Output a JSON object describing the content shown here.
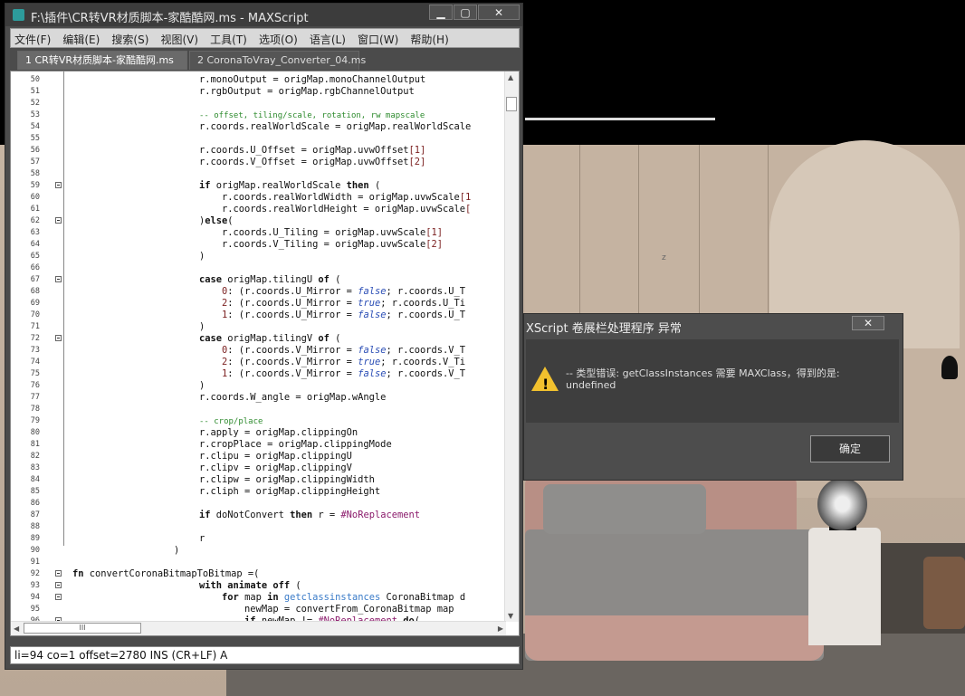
{
  "editor": {
    "title": "F:\\插件\\CR转VR材质脚本-家酷酷网.ms - MAXScript",
    "window_buttons": {
      "minimize": "▁",
      "maximize": "▢",
      "close": "✕"
    },
    "menu": [
      "文件(F)",
      "编辑(E)",
      "搜索(S)",
      "视图(V)",
      "工具(T)",
      "选项(O)",
      "语言(L)",
      "窗口(W)",
      "帮助(H)"
    ],
    "tabs": [
      "1 CR转VR材质脚本-家酷酷网.ms",
      "2 CoronaToVray_Converter_04.ms"
    ],
    "active_tab": 0,
    "lines": [
      {
        "n": "50",
        "html": "r.monoOutput = origMap.monoChannelOutput"
      },
      {
        "n": "51",
        "html": "r.rgbOutput = origMap.rgbChannelOutput"
      },
      {
        "n": "52",
        "html": ""
      },
      {
        "n": "53",
        "html": "<span class='cm'>-- offset, tiling/scale, rotation, rw mapscale</span>"
      },
      {
        "n": "54",
        "html": "r.coords.realWorldScale = origMap.realWorldScale"
      },
      {
        "n": "55",
        "html": ""
      },
      {
        "n": "56",
        "html": "r.coords.U_Offset = origMap.uvwOffset<span class='nm'>[1]</span>"
      },
      {
        "n": "57",
        "html": "r.coords.V_Offset = origMap.uvwOffset<span class='nm'>[2]</span>"
      },
      {
        "n": "58",
        "html": ""
      },
      {
        "n": "59",
        "html": "<span class='kw'>if</span> origMap.realWorldScale <span class='kw'>then</span> (",
        "fold": true
      },
      {
        "n": "60",
        "html": "    r.coords.realWorldWidth = origMap.uvwScale<span class='nm'>[1</span>"
      },
      {
        "n": "61",
        "html": "    r.coords.realWorldHeight = origMap.uvwScale<span class='nm'>[</span>"
      },
      {
        "n": "62",
        "html": ")<span class='kw'>else</span>(",
        "fold": true
      },
      {
        "n": "63",
        "html": "    r.coords.U_Tiling = origMap.uvwScale<span class='nm'>[1]</span>"
      },
      {
        "n": "64",
        "html": "    r.coords.V_Tiling = origMap.uvwScale<span class='nm'>[2]</span>"
      },
      {
        "n": "65",
        "html": ")"
      },
      {
        "n": "66",
        "html": ""
      },
      {
        "n": "67",
        "html": "<span class='kw'>case</span> origMap.tilingU <span class='kw'>of</span> (",
        "fold": true
      },
      {
        "n": "68",
        "html": "    <span class='nm'>0</span>: (r.coords.U_Mirror = <span class='it'>false</span>; r.coords.U_T"
      },
      {
        "n": "69",
        "html": "    <span class='nm'>2</span>: (r.coords.U_Mirror = <span class='it'>true</span>; r.coords.U_Ti"
      },
      {
        "n": "70",
        "html": "    <span class='nm'>1</span>: (r.coords.U_Mirror = <span class='it'>false</span>; r.coords.U_T"
      },
      {
        "n": "71",
        "html": ")"
      },
      {
        "n": "72",
        "html": "<span class='kw'>case</span> origMap.tilingV <span class='kw'>of</span> (",
        "fold": true
      },
      {
        "n": "73",
        "html": "    <span class='nm'>0</span>: (r.coords.V_Mirror = <span class='it'>false</span>; r.coords.V_T"
      },
      {
        "n": "74",
        "html": "    <span class='nm'>2</span>: (r.coords.V_Mirror = <span class='it'>true</span>; r.coords.V_Ti"
      },
      {
        "n": "75",
        "html": "    <span class='nm'>1</span>: (r.coords.V_Mirror = <span class='it'>false</span>; r.coords.V_T"
      },
      {
        "n": "76",
        "html": ")"
      },
      {
        "n": "77",
        "html": "r.coords.W_angle = origMap.wAngle"
      },
      {
        "n": "78",
        "html": ""
      },
      {
        "n": "79",
        "html": "<span class='cm'>-- crop/place</span>"
      },
      {
        "n": "80",
        "html": "r.apply = origMap.clippingOn"
      },
      {
        "n": "81",
        "html": "r.cropPlace = origMap.clippingMode"
      },
      {
        "n": "82",
        "html": "r.clipu = origMap.clippingU"
      },
      {
        "n": "83",
        "html": "r.clipv = origMap.clippingV"
      },
      {
        "n": "84",
        "html": "r.clipw = origMap.clippingWidth"
      },
      {
        "n": "85",
        "html": "r.cliph = origMap.clippingHeight"
      },
      {
        "n": "86",
        "html": ""
      },
      {
        "n": "87",
        "html": "<span class='kw'>if</span> doNotConvert <span class='kw'>then</span> r = <span class='sym'>#NoReplacement</span>"
      },
      {
        "n": "88",
        "html": ""
      },
      {
        "n": "89",
        "html": "r"
      },
      {
        "n": "90",
        "html": ")",
        "indent": -2
      },
      {
        "n": "91",
        "html": "",
        "indent": -3
      },
      {
        "n": "92",
        "html": "<span class='kw'>fn</span> convertCoronaBitmapToBitmap =(",
        "indent": -3,
        "fold": true
      },
      {
        "n": "93",
        "html": "<span class='kw'>with</span> <span class='kw'>animate</span> <span class='kw'>off</span> (",
        "fold": true
      },
      {
        "n": "94",
        "html": "    <span class='kw'>for</span> map <span class='kw'>in</span> <span style='color:#3a7bc8'>getclassinstances</span> CoronaBitmap d",
        "fold": true
      },
      {
        "n": "95",
        "html": "        newMap = convertFrom_CoronaBitmap map"
      },
      {
        "n": "96",
        "html": "        <span class='kw'>if</span> newMap != <span class='sym'>#NoReplacement</span> <span class='kw'>do</span>(",
        "fold": true
      }
    ],
    "status": "li=94 co=1 offset=2780 INS (CR+LF) A",
    "hscroll_thumb": "III"
  },
  "dialog": {
    "title": "XScript 卷展栏处理程序 异常",
    "close": "✕",
    "message": "-- 类型错误: getClassInstances 需要 MAXClass，得到的是: undefined",
    "ok": "确定"
  },
  "viewport": {
    "axis_label": "z"
  }
}
